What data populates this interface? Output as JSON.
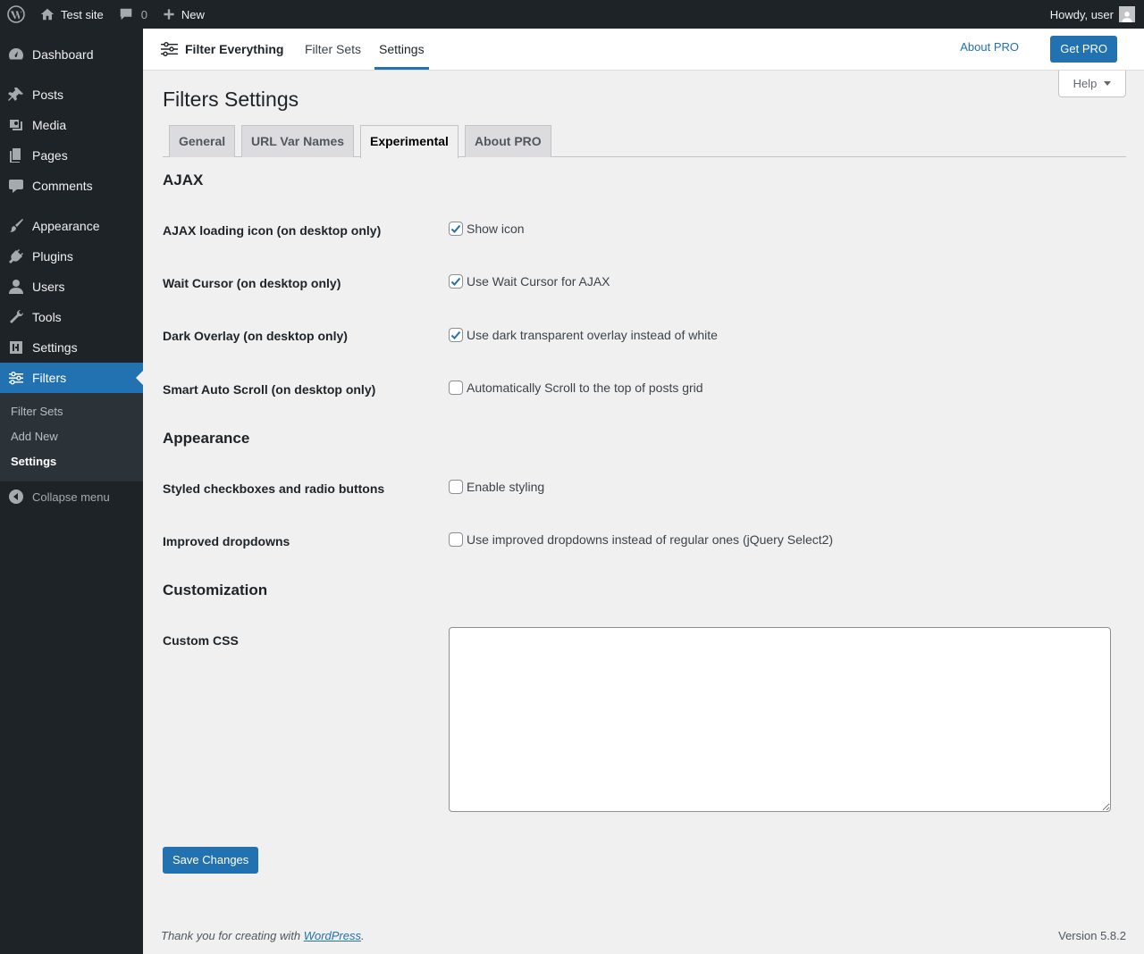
{
  "adminbar": {
    "site_name": "Test site",
    "comments_count": "0",
    "new_label": "New",
    "greeting": "Howdy, user"
  },
  "sidebar": {
    "items": [
      {
        "label": "Dashboard",
        "icon": "dashboard-icon"
      },
      {
        "label": "Posts",
        "icon": "pin-icon"
      },
      {
        "label": "Media",
        "icon": "media-icon"
      },
      {
        "label": "Pages",
        "icon": "pages-icon"
      },
      {
        "label": "Comments",
        "icon": "comment-icon"
      },
      {
        "label": "Appearance",
        "icon": "brush-icon"
      },
      {
        "label": "Plugins",
        "icon": "plug-icon"
      },
      {
        "label": "Users",
        "icon": "user-icon"
      },
      {
        "label": "Tools",
        "icon": "wrench-icon"
      },
      {
        "label": "Settings",
        "icon": "settings-icon"
      },
      {
        "label": "Filters",
        "icon": "sliders-icon"
      }
    ],
    "submenu": [
      "Filter Sets",
      "Add New",
      "Settings"
    ],
    "collapse_label": "Collapse menu"
  },
  "plugin_bar": {
    "brand": "Filter Everything",
    "tabs": [
      "Filter Sets",
      "Settings"
    ],
    "about_pro": "About PRO",
    "get_pro": "Get PRO"
  },
  "help_label": "Help",
  "page_title": "Filters Settings",
  "tabs": [
    "General",
    "URL Var Names",
    "Experimental",
    "About PRO"
  ],
  "active_tab": "Experimental",
  "sections": {
    "ajax": {
      "title": "AJAX",
      "rows": [
        {
          "label": "AJAX loading icon (on desktop only)",
          "option": "Show icon",
          "checked": true
        },
        {
          "label": "Wait Cursor (on desktop only)",
          "option": "Use Wait Cursor for AJAX",
          "checked": true
        },
        {
          "label": "Dark Overlay (on desktop only)",
          "option": "Use dark transparent overlay instead of white",
          "checked": true
        },
        {
          "label": "Smart Auto Scroll (on desktop only)",
          "option": "Automatically Scroll to the top of posts grid",
          "checked": false
        }
      ]
    },
    "appearance": {
      "title": "Appearance",
      "rows": [
        {
          "label": "Styled checkboxes and radio buttons",
          "option": "Enable styling",
          "checked": false
        },
        {
          "label": "Improved dropdowns",
          "option": "Use improved dropdowns instead of regular ones (jQuery Select2)",
          "checked": false
        }
      ]
    },
    "customization": {
      "title": "Customization",
      "custom_css_label": "Custom CSS",
      "custom_css_value": ""
    }
  },
  "save_label": "Save Changes",
  "footer": {
    "thanks_prefix": "Thank you for creating with ",
    "thanks_link": "WordPress",
    "thanks_suffix": ".",
    "version": "Version 5.8.2"
  },
  "colors": {
    "accent": "#2271b1",
    "admin_dark": "#1d2327",
    "background": "#f0f0f1"
  }
}
